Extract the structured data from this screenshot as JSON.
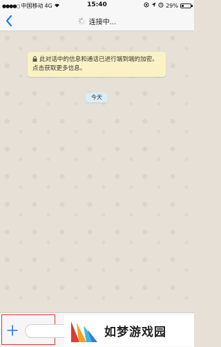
{
  "status_bar": {
    "carrier": "中国移动",
    "network": "4G",
    "time": "15:40",
    "battery_percent": "29%",
    "battery_level": 0.29
  },
  "nav": {
    "title": "连接中..."
  },
  "chat": {
    "encryption_notice": "此对话中的信息和通话已进行端到端的加密。点击获取更多信息。",
    "day_label": "今天"
  },
  "watermark": {
    "text": "如梦游戏园"
  },
  "colors": {
    "accent": "#1a7cf0",
    "notice_bg": "#faf2c4",
    "day_bg": "#d9eef7",
    "highlight": "#e2332b"
  }
}
